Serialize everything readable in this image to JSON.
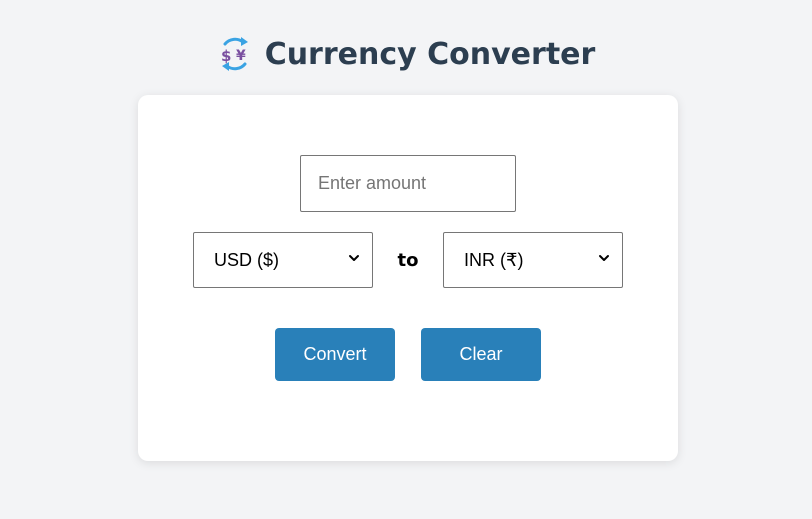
{
  "header": {
    "title": "Currency Converter",
    "icon": "currency-exchange-icon"
  },
  "form": {
    "amount": {
      "value": "",
      "placeholder": "Enter amount"
    },
    "from_currency": {
      "selected": "USD ($)"
    },
    "connector": "to",
    "to_currency": {
      "selected": "INR (₹)"
    }
  },
  "buttons": {
    "convert_label": "Convert",
    "clear_label": "Clear"
  },
  "colors": {
    "background": "#f3f4f6",
    "title": "#2c3e50",
    "button": "#2980b9",
    "card": "#ffffff"
  }
}
